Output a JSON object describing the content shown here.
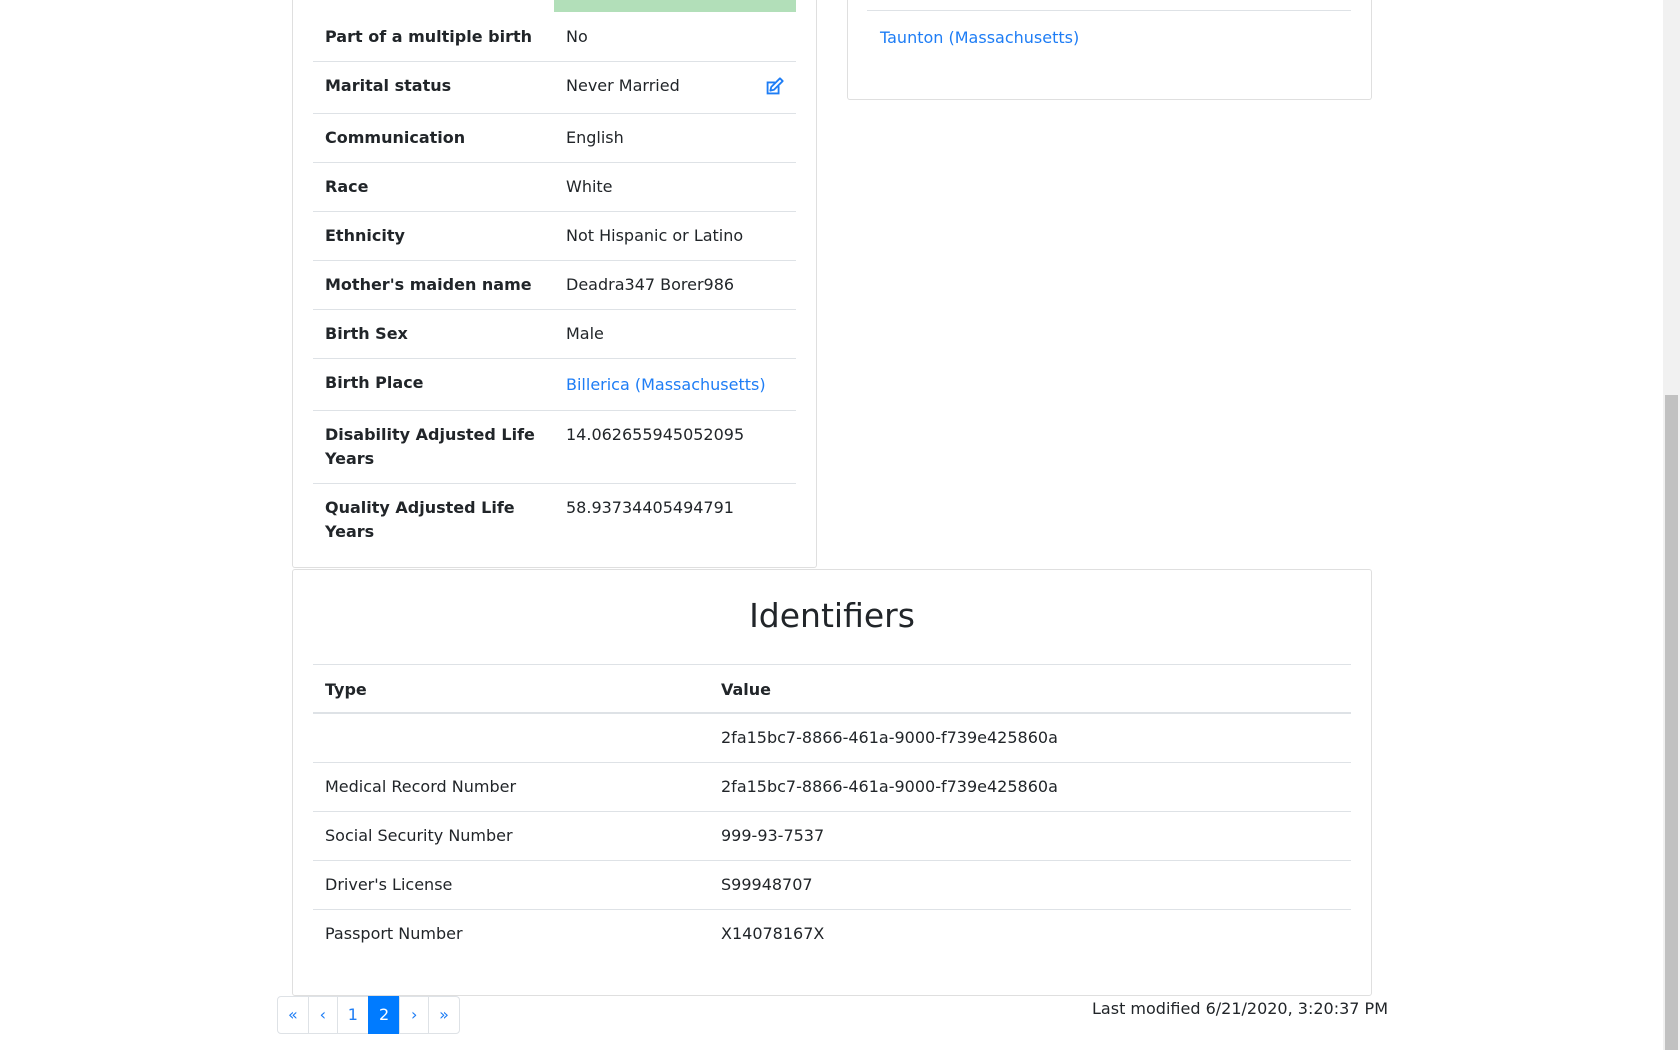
{
  "demographics": {
    "rows": [
      {
        "label": "Part of a multiple birth",
        "value": "No"
      },
      {
        "label": "Marital status",
        "value": "Never Married"
      },
      {
        "label": "Communication",
        "value": "English"
      },
      {
        "label": "Race",
        "value": "White"
      },
      {
        "label": "Ethnicity",
        "value": "Not Hispanic or Latino"
      },
      {
        "label": "Mother's maiden name",
        "value": "Deadra347 Borer986"
      },
      {
        "label": "Birth Sex",
        "value": "Male"
      },
      {
        "label": "Birth Place",
        "value": "Billerica (Massachusetts)"
      },
      {
        "label": "Disability Adjusted Life Years",
        "value": "14.062655945052095"
      },
      {
        "label": "Quality Adjusted Life Years",
        "value": "58.93734405494791"
      }
    ],
    "edit_icon": "edit-icon"
  },
  "address": {
    "link": "Taunton (Massachusetts)"
  },
  "identifiers": {
    "title": "Identifiers",
    "columns": [
      "Type",
      "Value"
    ],
    "rows": [
      {
        "type": "",
        "value": "2fa15bc7-8866-461a-9000-f739e425860a"
      },
      {
        "type": "Medical Record Number",
        "value": "2fa15bc7-8866-461a-9000-f739e425860a"
      },
      {
        "type": "Social Security Number",
        "value": "999-93-7537"
      },
      {
        "type": "Driver's License",
        "value": "S99948707"
      },
      {
        "type": "Passport Number",
        "value": "X14078167X"
      }
    ]
  },
  "pagination": {
    "first": "«",
    "prev": "‹",
    "pages": [
      "1",
      "2"
    ],
    "active_page": "2",
    "next": "›",
    "last": "»"
  },
  "footer": {
    "last_modified": "Last modified 6/21/2020, 3:20:37 PM"
  },
  "colors": {
    "link": "#1e7df5",
    "active_page": "#007bff",
    "highlight_bar": "#b2dfb9"
  }
}
